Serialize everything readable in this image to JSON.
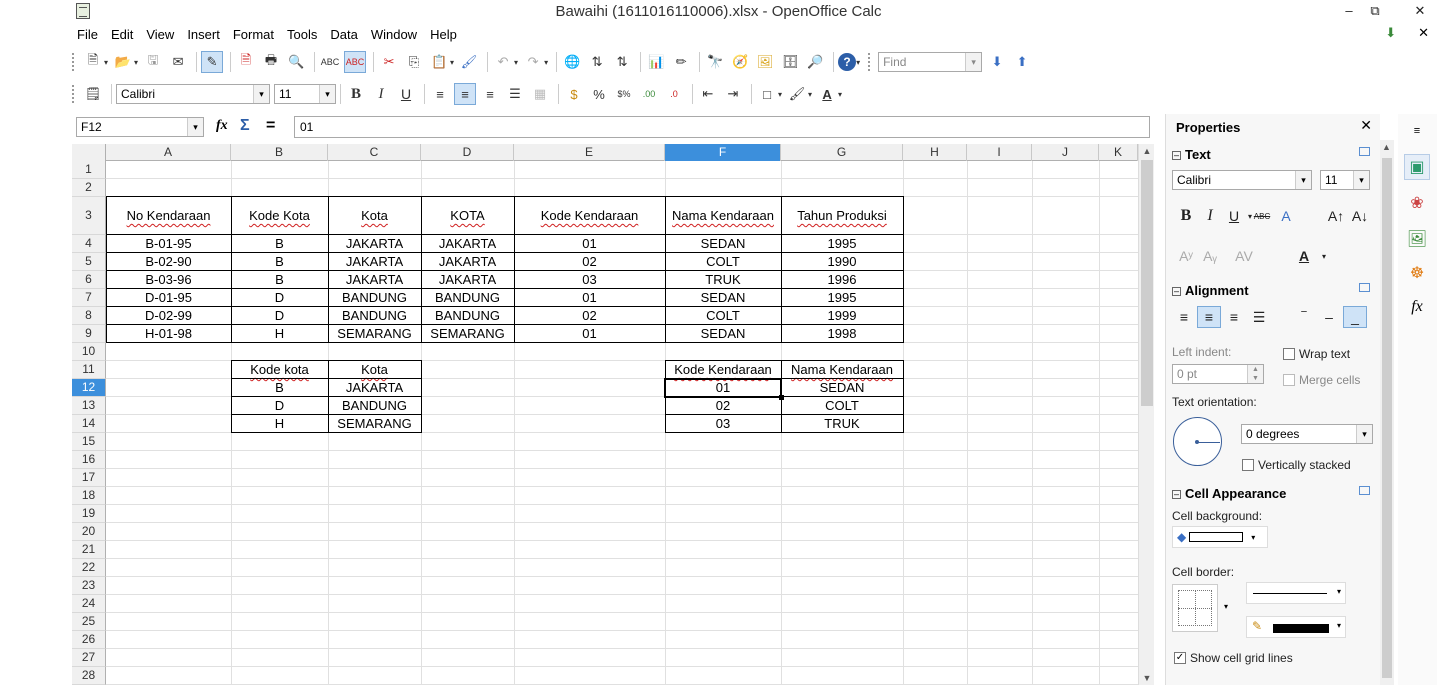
{
  "window": {
    "title": "Bawaihi  (1611016110006).xlsx - OpenOffice Calc",
    "minimize": "–",
    "restore": "⧉",
    "close": "✕"
  },
  "menu": [
    {
      "label": "File",
      "key": "F",
      "rest": "ile"
    },
    {
      "label": "Edit",
      "key": "E",
      "rest": "dit"
    },
    {
      "label": "View",
      "key": "V",
      "rest": "iew"
    },
    {
      "label": "Insert",
      "key": "I",
      "rest": "nsert"
    },
    {
      "label": "Format",
      "key": "o",
      "pre": "F",
      "rest": "rmat"
    },
    {
      "label": "Tools",
      "key": "T",
      "rest": "ools"
    },
    {
      "label": "Data",
      "key": "D",
      "rest": "ata"
    },
    {
      "label": "Window",
      "key": "W",
      "rest": "indow"
    },
    {
      "label": "Help",
      "key": "H",
      "rest": "elp"
    }
  ],
  "toolbar": {
    "find_placeholder": "Find",
    "font_name": "Calibri",
    "font_size": "11",
    "bold": "B",
    "italic": "I",
    "underline": "U"
  },
  "formula_bar": {
    "cell_ref": "F12",
    "function_wizard": "fx",
    "sum": "Σ",
    "equals": "=",
    "content": "01"
  },
  "columns": [
    "A",
    "B",
    "C",
    "D",
    "E",
    "F",
    "G",
    "H",
    "I",
    "J",
    "K"
  ],
  "selected_column": "F",
  "selected_row": 12,
  "rows": [
    "1",
    "2",
    "3",
    "4",
    "5",
    "6",
    "7",
    "8",
    "9",
    "10",
    "11",
    "12",
    "13",
    "14",
    "15",
    "16",
    "17",
    "18",
    "19",
    "20",
    "21",
    "22",
    "23",
    "24",
    "25",
    "26",
    "27",
    "28"
  ],
  "table1": {
    "headers": [
      "No Kendaraan",
      "Kode Kota",
      "Kota",
      "KOTA",
      "Kode Kendaraan",
      "Nama Kendaraan",
      "Tahun Produksi"
    ],
    "rows": [
      [
        "B-01-95",
        "B",
        "JAKARTA",
        "JAKARTA",
        "01",
        "SEDAN",
        "1995"
      ],
      [
        "B-02-90",
        "B",
        "JAKARTA",
        "JAKARTA",
        "02",
        "COLT",
        "1990"
      ],
      [
        "B-03-96",
        "B",
        "JAKARTA",
        "JAKARTA",
        "03",
        "TRUK",
        "1996"
      ],
      [
        "D-01-95",
        "D",
        "BANDUNG",
        "BANDUNG",
        "01",
        "SEDAN",
        "1995"
      ],
      [
        "D-02-99",
        "D",
        "BANDUNG",
        "BANDUNG",
        "02",
        "COLT",
        "1999"
      ],
      [
        "H-01-98",
        "H",
        "SEMARANG",
        "SEMARANG",
        "01",
        "SEDAN",
        "1998"
      ]
    ]
  },
  "table2": {
    "headers": [
      "Kode kota",
      "Kota"
    ],
    "rows": [
      [
        "B",
        "JAKARTA"
      ],
      [
        "D",
        "BANDUNG"
      ],
      [
        "H",
        "SEMARANG"
      ]
    ]
  },
  "table3": {
    "headers": [
      "Kode Kendaraan",
      "Nama Kendaraan"
    ],
    "rows": [
      [
        "01",
        "SEDAN"
      ],
      [
        "02",
        "COLT"
      ],
      [
        "03",
        "TRUK"
      ]
    ]
  },
  "sidebar": {
    "title": "Properties",
    "close": "✕",
    "text_section": "Text",
    "font_name": "Calibri",
    "font_size": "11",
    "alignment_section": "Alignment",
    "left_indent_label": "Left indent:",
    "left_indent_value": "0 pt",
    "wrap_text": "Wrap text",
    "merge_cells": "Merge cells",
    "text_orientation_label": "Text orientation:",
    "orientation_value": "0 degrees",
    "vertically_stacked": "Vertically stacked",
    "cell_appearance_section": "Cell Appearance",
    "cell_background_label": "Cell background:",
    "cell_border_label": "Cell border:",
    "show_grid_lines": "Show cell grid lines",
    "show_grid_lines_checked": "✓"
  }
}
